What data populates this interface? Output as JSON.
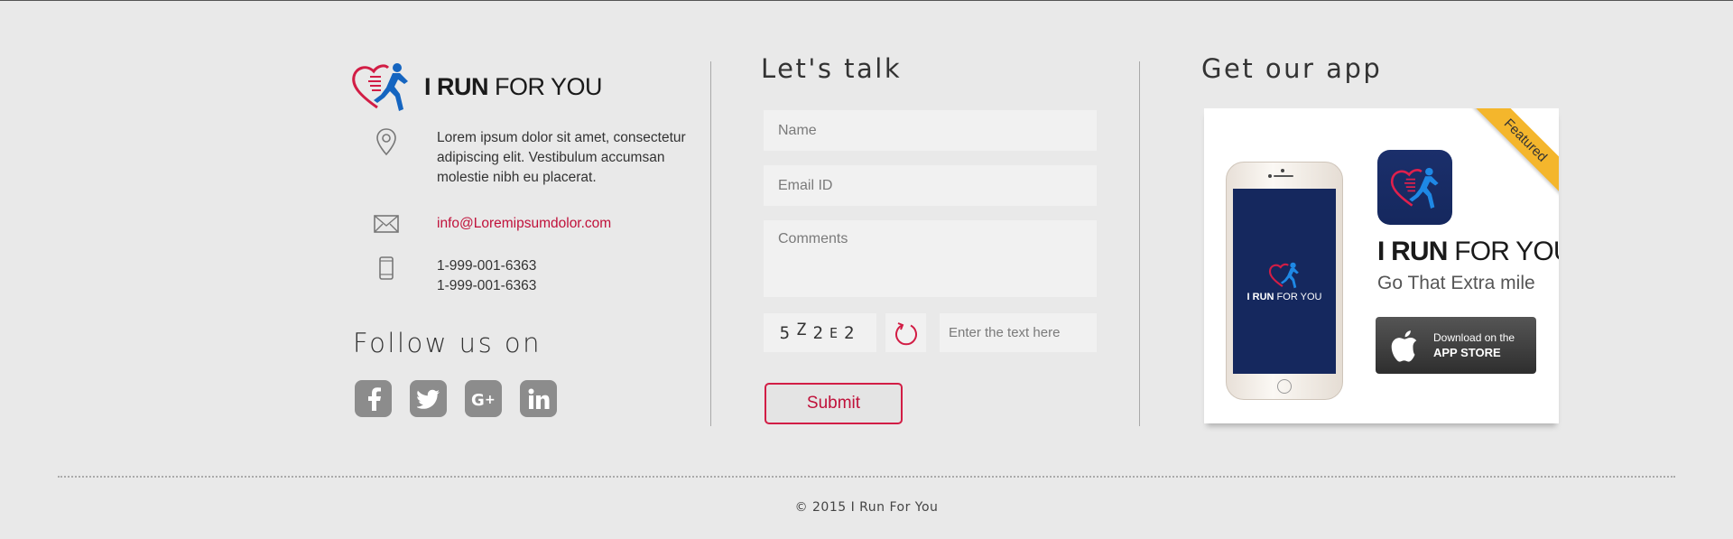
{
  "brand": {
    "name_bold": "I RUN",
    "name_regular": "FOR YOU"
  },
  "contact": {
    "address": "Lorem ipsum dolor sit amet, consectetur adipiscing elit. Vestibulum accumsan molestie nibh eu placerat.",
    "email": "info@Loremipsumdolor.com",
    "phone_1": "1-999-001-6363",
    "phone_2": "1-999-001-6363"
  },
  "social": {
    "title": "Follow us on",
    "items": [
      {
        "name": "facebook",
        "glyph": "f"
      },
      {
        "name": "twitter",
        "glyph": "twitter"
      },
      {
        "name": "google-plus",
        "glyph": "G+"
      },
      {
        "name": "linkedin",
        "glyph": "in"
      }
    ]
  },
  "form": {
    "title": "Let's talk",
    "name_placeholder": "Name",
    "email_placeholder": "Email ID",
    "comments_placeholder": "Comments",
    "captcha_chars": [
      "5",
      "Z",
      "2",
      "E",
      "2"
    ],
    "captcha_placeholder": "Enter the text here",
    "submit_label": "Submit"
  },
  "app": {
    "title": "Get our app",
    "ribbon": "Featured",
    "name_bold": "I RUN",
    "name_regular": "FOR YOU",
    "tagline": "Go That Extra mile",
    "screen_bold": "I RUN",
    "screen_regular": "FOR YOU",
    "store_small": "Download on the",
    "store_big": "APP STORE"
  },
  "footer": {
    "copyright": "© 2015 I Run For You"
  },
  "colors": {
    "background": "#e9e9e9",
    "accent": "#c0113a",
    "social_icon": "#8c8c8c",
    "ribbon": "#f4b62c",
    "app_blue": "#15285e",
    "runner_blue": "#1565c0"
  }
}
